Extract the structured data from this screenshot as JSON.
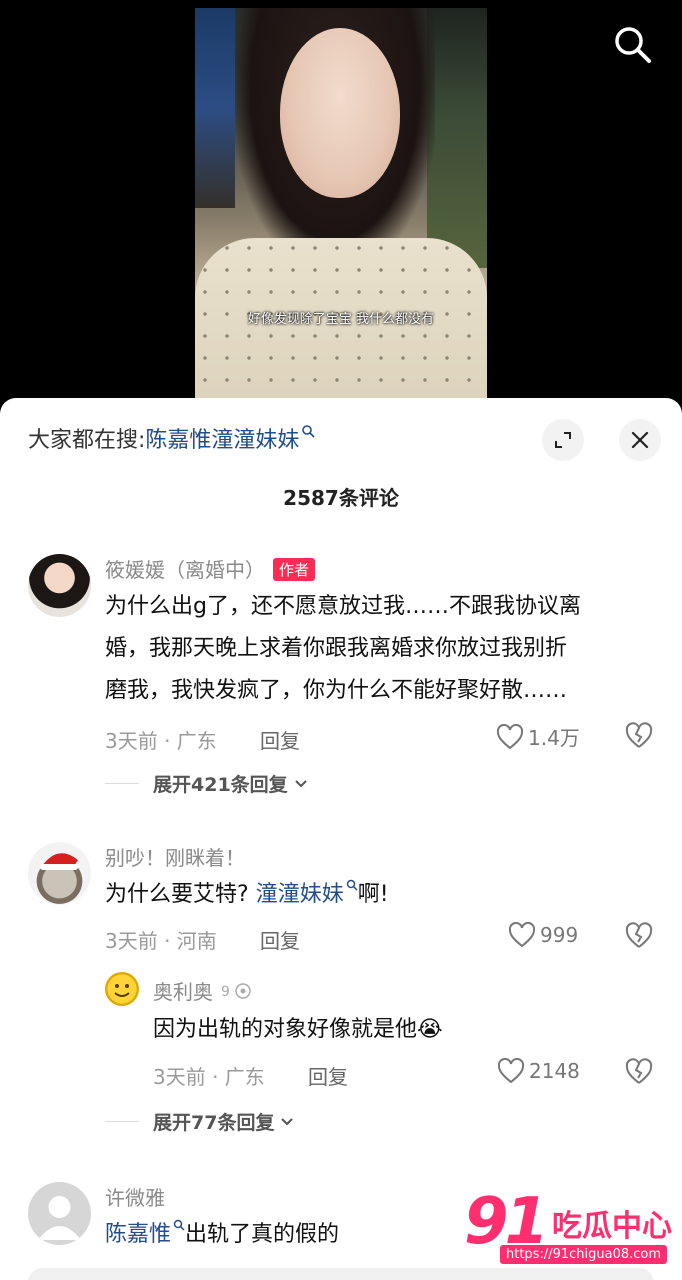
{
  "video": {
    "caption": "好像发现除了宝宝 我什么都没有"
  },
  "sheet": {
    "search_prefix": "大家都在搜:",
    "search_term": "陈嘉惟潼潼妹妹",
    "comment_count": "2587条评论"
  },
  "comments": [
    {
      "username": "筱媛媛（离婚中）",
      "author_tag": "作者",
      "text_lines": [
        "为什么出g了，还不愿意放过我……不跟我协议离",
        "婚，我那天晚上求着你跟我离婚求你放过我别折",
        "磨我，我快发疯了，你为什么不能好聚好散……"
      ],
      "meta": "3天前 · 广东",
      "reply_label": "回复",
      "likes": "1.4万",
      "expand_label": "展开421条回复"
    },
    {
      "username": "别吵！刚眯着！",
      "text_before": "为什么要艾特?",
      "mention": "潼潼妹妹",
      "text_after": "啊!",
      "meta": "3天前 · 河南",
      "reply_label": "回复",
      "likes": "999",
      "reply": {
        "username": "奥利奥",
        "text": "因为出轨的对象好像就是他",
        "emoji": "😭",
        "meta": "3天前 · 广东",
        "reply_label": "回复",
        "likes": "2148"
      },
      "expand_label": "展开77条回复"
    },
    {
      "username": "许微雅",
      "mention": "陈嘉惟",
      "text_after": "出轨了真的假的"
    }
  ],
  "watermark": {
    "number": "91",
    "text": "吃瓜中心",
    "url": "https://91chigua08.com"
  },
  "colors": {
    "mention": "#214d8e",
    "author_tag": "#fe2c55",
    "watermark": "#ff2e6e"
  }
}
